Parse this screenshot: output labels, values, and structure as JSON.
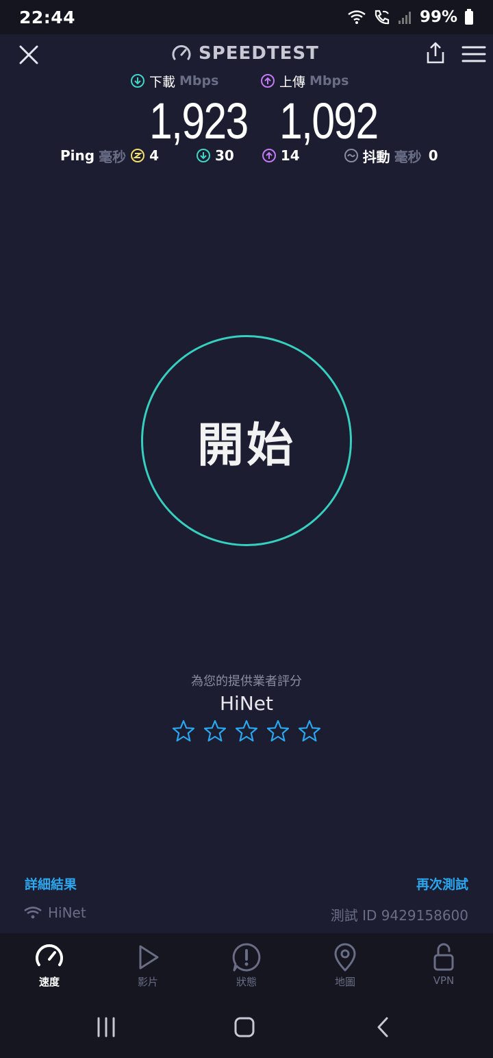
{
  "status": {
    "time": "22:44",
    "battery": "99%"
  },
  "header": {
    "brand": "SPEEDTEST"
  },
  "download": {
    "label": "下載",
    "unit": "Mbps",
    "value": "1,923"
  },
  "upload": {
    "label": "上傳",
    "unit": "Mbps",
    "value": "1,092"
  },
  "ping": {
    "label": "Ping",
    "unit": "毫秒",
    "idle": "4",
    "download": "30",
    "upload": "14",
    "jitter_label": "抖動",
    "jitter_unit": "毫秒",
    "jitter": "0"
  },
  "go_button": {
    "label": "開始",
    "ring_color": "#36cfc0"
  },
  "rating": {
    "prompt": "為您的提供業者評分",
    "provider": "HiNet",
    "stars_total": 5,
    "stars_filled": 0
  },
  "links": {
    "details": "詳細結果",
    "retest": "再次測試"
  },
  "connection": {
    "network": "HiNet",
    "test_id": "測試 ID 9429158600"
  },
  "tabs": [
    {
      "label": "速度",
      "icon": "speedometer-icon",
      "active": true
    },
    {
      "label": "影片",
      "icon": "play-icon",
      "active": false
    },
    {
      "label": "狀態",
      "icon": "alert-bubble-icon",
      "active": false
    },
    {
      "label": "地圖",
      "icon": "map-pin-icon",
      "active": false
    },
    {
      "label": "VPN",
      "icon": "lock-open-icon",
      "active": false
    }
  ],
  "colors": {
    "background": "#1c1d31",
    "download_accent": "#3fd6c6",
    "upload_accent": "#c27af5",
    "ping_accent": "#f2e06a",
    "link": "#2ba7ef",
    "star": "#2ba7ef"
  }
}
